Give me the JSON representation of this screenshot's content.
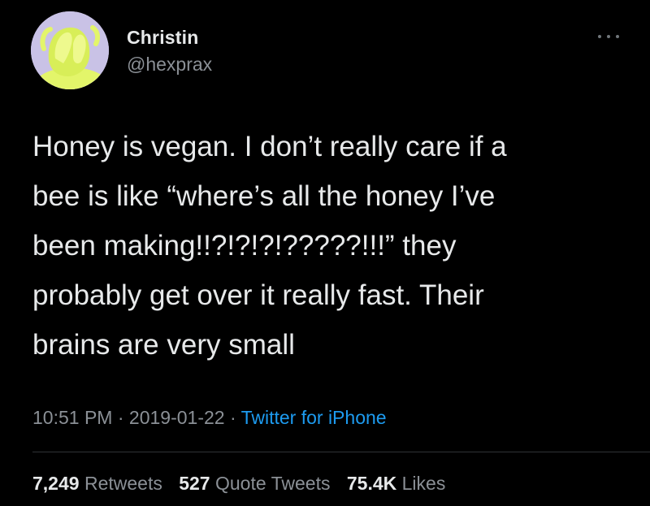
{
  "author": {
    "display_name": "Christin",
    "handle": "@hexprax",
    "avatar_icon": "avatar-hands-covering-face"
  },
  "menu": {
    "icon": "more-options-icon"
  },
  "tweet": {
    "text": "Honey is vegan. I don’t really care if a\nbee is like “where’s all the honey I’ve\nbeen making!!?!?!?!?????!!!” they\nprobably get over it really fast. Their\nbrains are very small"
  },
  "meta": {
    "time": "10:51 PM",
    "separator": " · ",
    "date": "2019-01-22",
    "source": "Twitter for iPhone"
  },
  "stats": {
    "retweets_count": "7,249",
    "retweets_label": "Retweets",
    "quotes_count": "527",
    "quotes_label": "Quote Tweets",
    "likes_count": "75.4K",
    "likes_label": "Likes"
  },
  "colors": {
    "background": "#000000",
    "text": "#e7e9ea",
    "secondary_text": "#8b9096",
    "link": "#1d9bf0",
    "avatar_bg": "#c9c2e6",
    "avatar_accent": "#e3f56a"
  }
}
